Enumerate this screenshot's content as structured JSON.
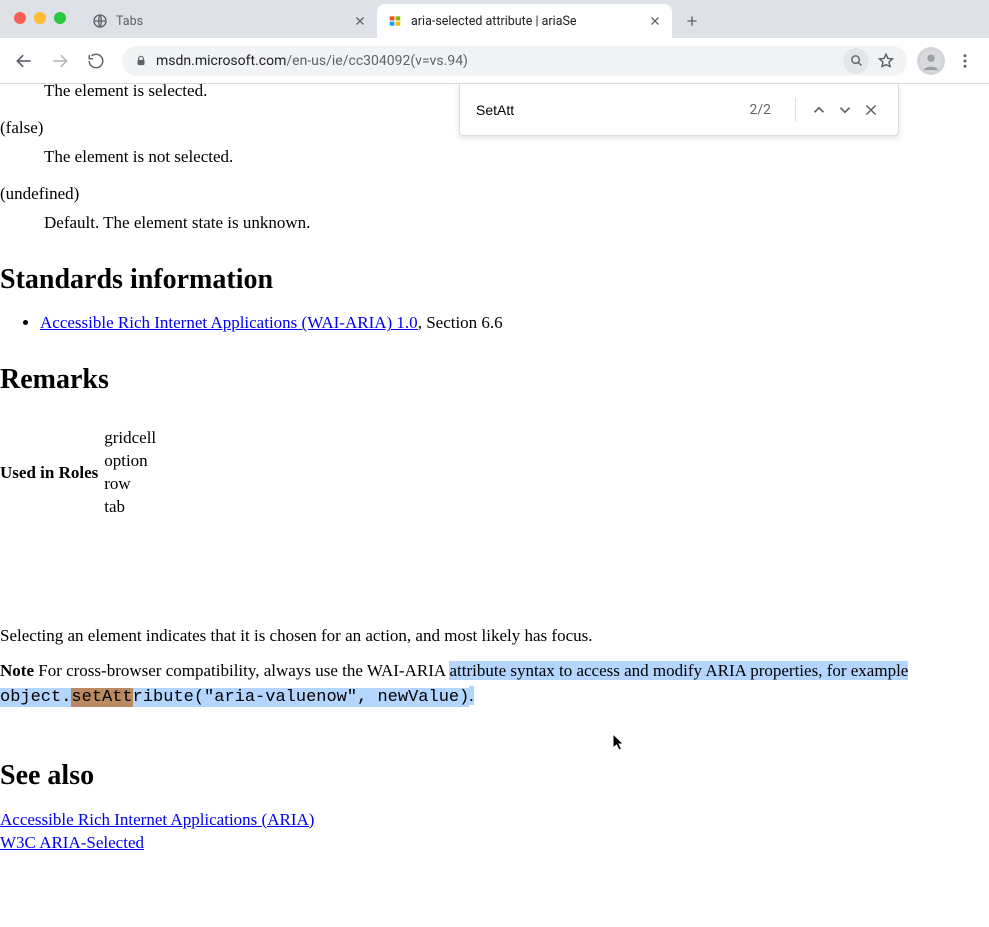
{
  "tabs": {
    "inactive": {
      "title": "Tabs"
    },
    "active": {
      "title": "aria-selected attribute | ariaSe"
    }
  },
  "address": {
    "host": "msdn.microsoft.com",
    "path": "/en-us/ie/cc304092(v=vs.94)"
  },
  "find": {
    "query": "SetAtt",
    "count": "2/2"
  },
  "doc": {
    "true_dd": "The element is selected.",
    "false_dt": "(false)",
    "false_dd": "The element is not selected.",
    "undef_dt": "(undefined)",
    "undef_dd": "Default. The element state is unknown.",
    "h_standards": "Standards information",
    "std_link": "Accessible Rich Internet Applications (WAI-ARIA) 1.0",
    "std_suffix": ", Section 6.6",
    "h_remarks": "Remarks",
    "roles_label": "Used in Roles",
    "roles": [
      "gridcell",
      "option",
      "row",
      "tab"
    ],
    "select_para": "Selecting an element indicates that it is chosen for an action, and most likely has focus.",
    "note_b": "Note",
    "note_pre": "  For cross-browser compatibility, always use the WAI-ARIA ",
    "note_sel1": "attribute syntax to access and modify ARIA properties, for example ",
    "code_pre": "object.",
    "code_hl": "setAtt",
    "code_post": "ribute(\"aria-valuenow\", newValue)",
    "note_sel_end": ".",
    "h_seealso": "See also",
    "seealso": [
      "Accessible Rich Internet Applications (ARIA)",
      "W3C ARIA-Selected"
    ]
  }
}
